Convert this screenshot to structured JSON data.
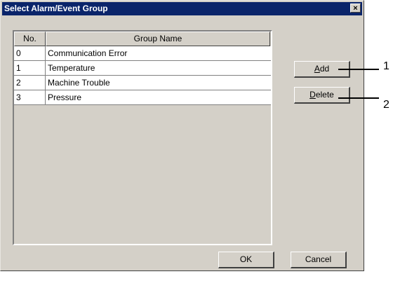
{
  "window": {
    "title": "Select Alarm/Event Group",
    "close_glyph": "×"
  },
  "table": {
    "columns": [
      "No.",
      "Group Name"
    ],
    "rows": [
      {
        "no": "0",
        "name": "Communication Error"
      },
      {
        "no": "1",
        "name": "Temperature"
      },
      {
        "no": "2",
        "name": "Machine Trouble"
      },
      {
        "no": "3",
        "name": "Pressure"
      }
    ]
  },
  "buttons": {
    "add": {
      "mnemonic": "A",
      "rest": "dd"
    },
    "delete": {
      "mnemonic": "D",
      "rest": "elete"
    },
    "ok": "OK",
    "cancel": "Cancel"
  },
  "callouts": [
    "1",
    "2"
  ]
}
